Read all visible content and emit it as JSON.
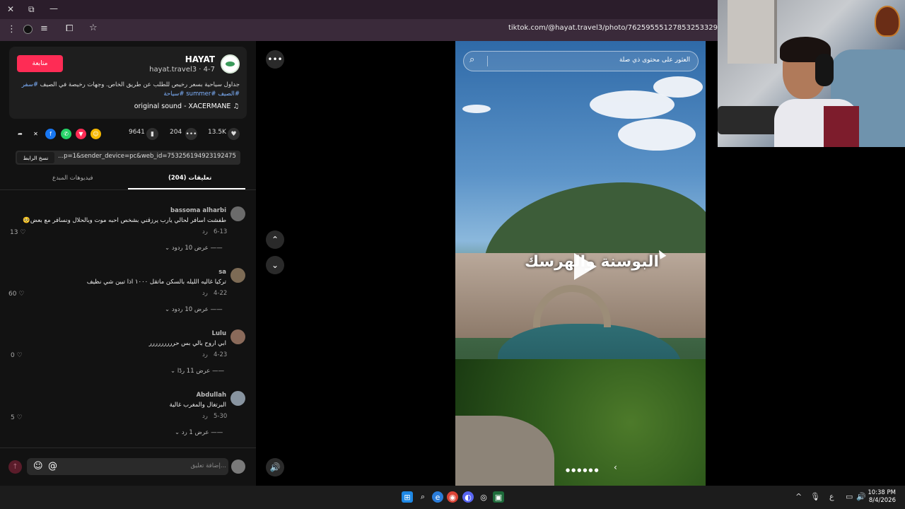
{
  "browser": {
    "url": "tiktok.com/@hayat.travel3/photo/76259555127853253329"
  },
  "profile": {
    "follow_label": "متابعة",
    "name": "HAYAT",
    "handle": "hayat.travel3 · 4-7",
    "description_text": "جداول سياحية بسعر رخيص للطلب عن طريق الخاص. وجهات رخيصة في الصيف ",
    "tags": [
      "#سفر",
      "#الصيف",
      "#summer",
      "#سياحة"
    ],
    "sound": "original sound - XACERMANE"
  },
  "stats": {
    "likes": "13.5K",
    "comments": "204",
    "saves": "9641"
  },
  "link": {
    "copy_label": "نسخ الرابط",
    "text": "...p=1&sender_device=pc&web_id=7532561949231924756"
  },
  "tabs": {
    "comments": "تعليقات (204)",
    "creator_videos": "فيديوهات المبدع"
  },
  "comments": [
    {
      "name": "bassoma alharbi",
      "text": "طفشت اسافر لحالي يارب يرزقني بشخص احبه موت وبالحلال ونسافر مع بعض🥺",
      "date": "6-13",
      "reply": "رد",
      "likes": "13",
      "replies": "عرض 10 ردود"
    },
    {
      "name": "sa",
      "text": "تركيا غاليه الليله بالسكن ماتقل ١٠٠٠ اذا تبين شي نظيف",
      "date": "4-22",
      "reply": "رد",
      "likes": "60",
      "replies": "عرض 10 ردود"
    },
    {
      "name": "Lulu",
      "text": "ابي اروح بالي بس حررررررررر",
      "date": "4-23",
      "reply": "رد",
      "likes": "0",
      "replies": "عرض 11 ردًا"
    },
    {
      "name": "Abdullah",
      "text": "البرتغال والمغرب غالية",
      "date": "5-30",
      "reply": "رد",
      "likes": "5",
      "replies": "عرض 1 رد"
    }
  ],
  "comment_input": {
    "placeholder": "إضافة تعليق..."
  },
  "video": {
    "search_placeholder": "العثور على محتوى ذي صلة",
    "overlay_text": "البوسنة والهرسك"
  },
  "taskbar": {
    "time": "10:38 PM",
    "date": "8/4/2026",
    "lang": "ع"
  }
}
